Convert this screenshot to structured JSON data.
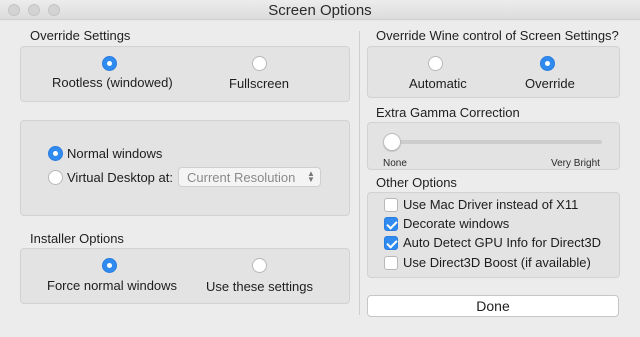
{
  "window": {
    "title": "Screen Options"
  },
  "override_settings": {
    "label": "Override Settings",
    "options": [
      "Rootless (windowed)",
      "Fullscreen"
    ],
    "selected": "Rootless (windowed)"
  },
  "window_mode": {
    "options": [
      "Normal windows",
      "Virtual Desktop at:"
    ],
    "selected": "Normal windows",
    "resolution_value": "Current Resolution"
  },
  "installer_options": {
    "label": "Installer Options",
    "options": [
      "Force normal windows",
      "Use these settings"
    ],
    "selected": "Force normal windows"
  },
  "override_wine": {
    "label": "Override Wine control of Screen Settings?",
    "options": [
      "Automatic",
      "Override"
    ],
    "selected": "Override"
  },
  "gamma": {
    "label": "Extra Gamma Correction",
    "min_label": "None",
    "max_label": "Very Bright",
    "value": 0
  },
  "other_options": {
    "label": "Other Options",
    "items": [
      {
        "label": "Use Mac Driver instead of X11",
        "checked": false
      },
      {
        "label": "Decorate windows",
        "checked": true
      },
      {
        "label": "Auto Detect GPU Info for Direct3D",
        "checked": true
      },
      {
        "label": "Use Direct3D Boost (if available)",
        "checked": false
      }
    ]
  },
  "done_button": "Done",
  "colors": {
    "accent": "#2f8bf0",
    "background": "#ececec",
    "group": "#e3e3e3"
  }
}
